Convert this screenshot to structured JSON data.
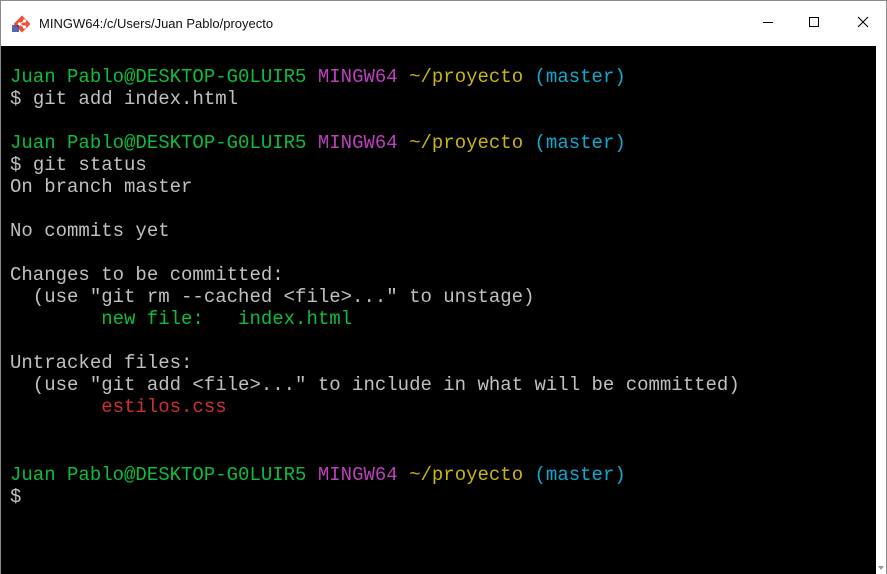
{
  "window": {
    "title": "MINGW64:/c/Users/Juan Pablo/proyecto",
    "app_icon": "git-bash-diamond-icon",
    "controls": {
      "minimize_icon": "minimize-icon",
      "maximize_icon": "maximize-icon",
      "close_icon": "close-icon"
    }
  },
  "colors": {
    "prompt_user": "#0dbc3d",
    "prompt_env": "#bc3fbc",
    "prompt_path": "#c8b415",
    "prompt_branch": "#11a8cd",
    "text": "#c0c0c0",
    "staged_file": "#0dbc3d",
    "untracked_file": "#cd3131",
    "background": "#000000"
  },
  "prompt": {
    "user_host": "Juan Pablo@DESKTOP-G0LUIR5",
    "env": "MINGW64",
    "path": "~/proyecto",
    "branch": "(master)",
    "symbol": "$"
  },
  "terminal": {
    "cmd1": "git add index.html",
    "cmd2": "git status",
    "on_branch": "On branch master",
    "no_commits": "No commits yet",
    "changes_header": "Changes to be committed:",
    "unstage_hint": "  (use \"git rm --cached <file>...\" to unstage)",
    "new_file_label": "        new file:   ",
    "new_file_name": "index.html",
    "untracked_header": "Untracked files:",
    "include_hint": "  (use \"git add <file>...\" to include in what will be committed)",
    "untracked_indent": "        ",
    "untracked_file": "estilos.css"
  }
}
